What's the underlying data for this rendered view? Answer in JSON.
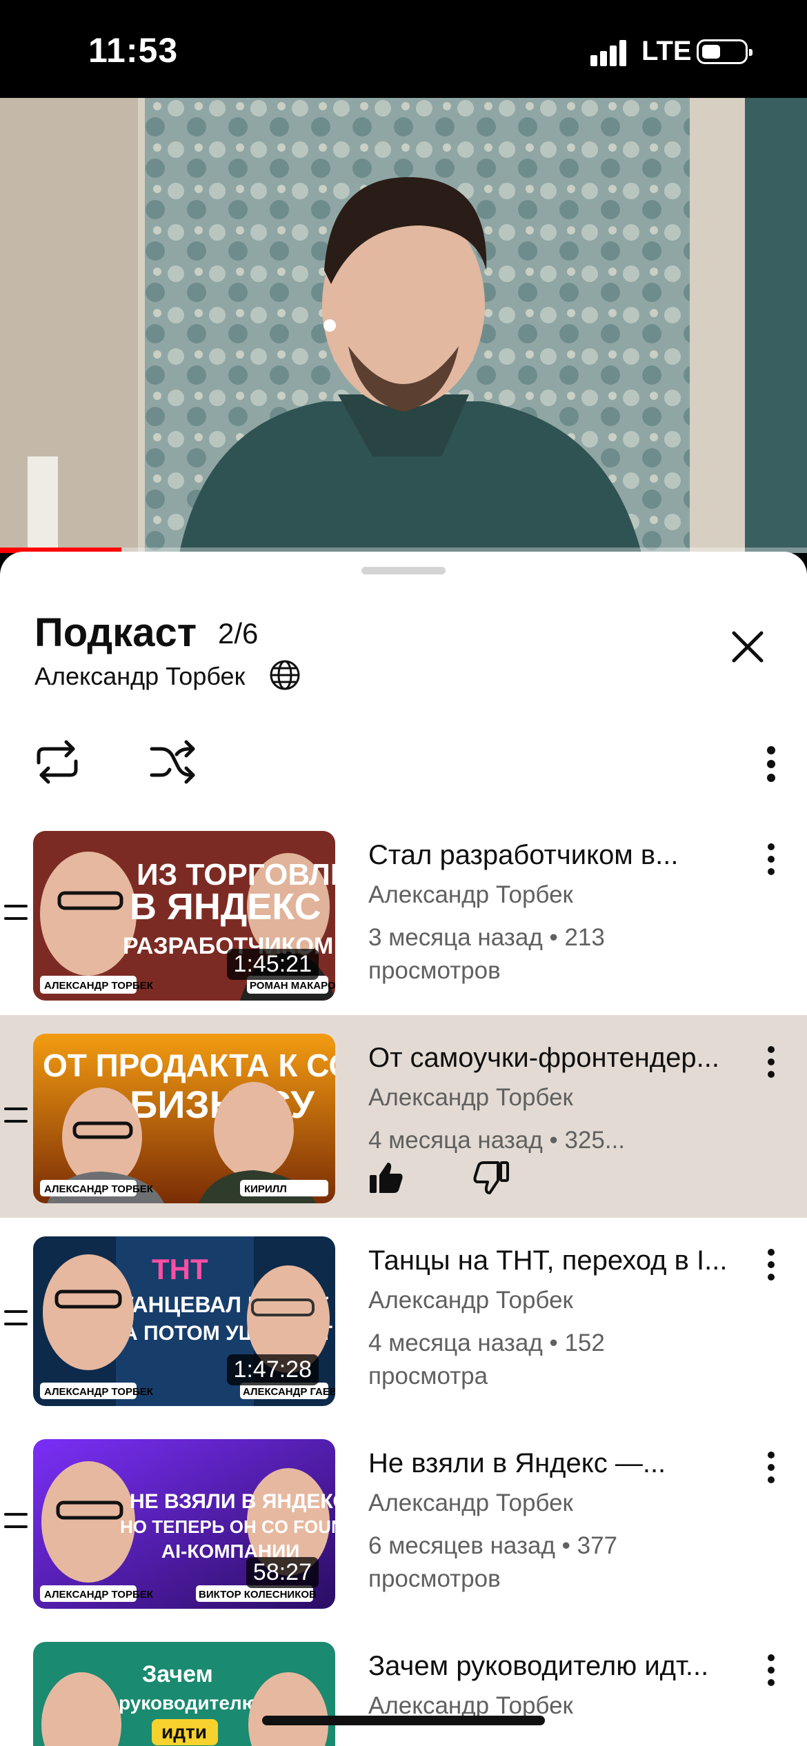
{
  "status_bar": {
    "time": "11:53",
    "network": "LTE",
    "battery_icon": "battery-icon",
    "signal_icon": "signal-bars-icon"
  },
  "player": {
    "progress_fraction": 0.15,
    "accent_color": "#ff0000"
  },
  "playlist": {
    "title": "Подкаст",
    "position": "2/6",
    "owner": "Александр Торбек",
    "visibility_icon": "globe-icon",
    "controls": {
      "loop_icon": "loop-icon",
      "shuffle_icon": "shuffle-icon",
      "more_icon": "more-vert-icon",
      "close_icon": "close-icon"
    },
    "items": [
      {
        "title": "Стал разработчиком в...",
        "channel": "Александр Торбек",
        "meta": "3 месяца назад • 213 просмотров",
        "duration": "1:45:21",
        "thumb": {
          "line1": "ИЗ ТОРГОВЛИ",
          "line2": "В ЯНДЕКС",
          "line3": "РАЗРАБОТЧИКОМ",
          "left_name": "АЛЕКСАНДР ТОРБЕК",
          "right_name": "РОМАН МАКАРОВ"
        }
      },
      {
        "title": "От самоучки-фронтендер...",
        "channel": "Александр Торбек",
        "meta": "4 месяца назад • 325...",
        "duration": "",
        "active": true,
        "thumb": {
          "line1": "ОТ ПРОДАКТА К СОЛО",
          "line2": "БИЗНЕСУ",
          "left_name": "АЛЕКСАНДР ТОРБЕК",
          "right_name": "КИРИЛЛ"
        }
      },
      {
        "title": "Танцы на ТНТ, переход в I...",
        "channel": "Александр Торбек",
        "meta": "4 месяца назад • 152 просмотра",
        "duration": "1:47:28",
        "thumb": {
          "logo": "ТНТ",
          "line1": "ТАНЦЕВАЛ НА ТНТ",
          "line2": "А ПОТОМ УШЕЛ В IT",
          "left_name": "АЛЕКСАНДР ТОРБЕК",
          "right_name": "АЛЕКСАНДР ГАЕВ"
        }
      },
      {
        "title": "Не взяли в Яндекс —...",
        "channel": "Александр Торбек",
        "meta": "6 месяцев назад • 377 просмотров",
        "duration": "58:27",
        "thumb": {
          "line1": "НЕ ВЗЯЛИ В ЯНДЕКС,",
          "line2": "НО ТЕПЕРЬ ОН CO FOUNDER",
          "line3": "AI-КОМПАНИИ",
          "left_name": "АЛЕКСАНДР ТОРБЕК",
          "right_name": "ВИКТОР КОЛЕСНИКОВ"
        }
      },
      {
        "title": "Зачем руководителю идт...",
        "channel": "Александр Торбек",
        "meta": "",
        "duration": "",
        "thumb": {
          "line1": "Зачем",
          "line2": "руководителю",
          "line3": "идти"
        }
      }
    ]
  }
}
